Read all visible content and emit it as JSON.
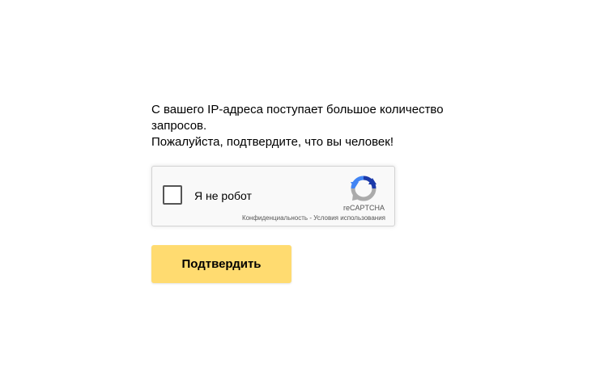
{
  "message": {
    "line1": "С вашего IP-адреса поступает большое количество",
    "line2": "запросов.",
    "line3": "Пожалуйста, подтвердите, что вы человек!"
  },
  "recaptcha": {
    "checkbox_label": "Я не робот",
    "brand": "reCAPTCHA",
    "privacy_link": "Конфиденциальность",
    "separator": " - ",
    "terms_link": "Условия использования",
    "logo_icon": "recaptcha-logo-icon",
    "background_color": "#f9f9f9",
    "border_color": "#d3d3d3"
  },
  "submit_button": {
    "label": "Подтвердить",
    "color": "#ffdb70"
  }
}
